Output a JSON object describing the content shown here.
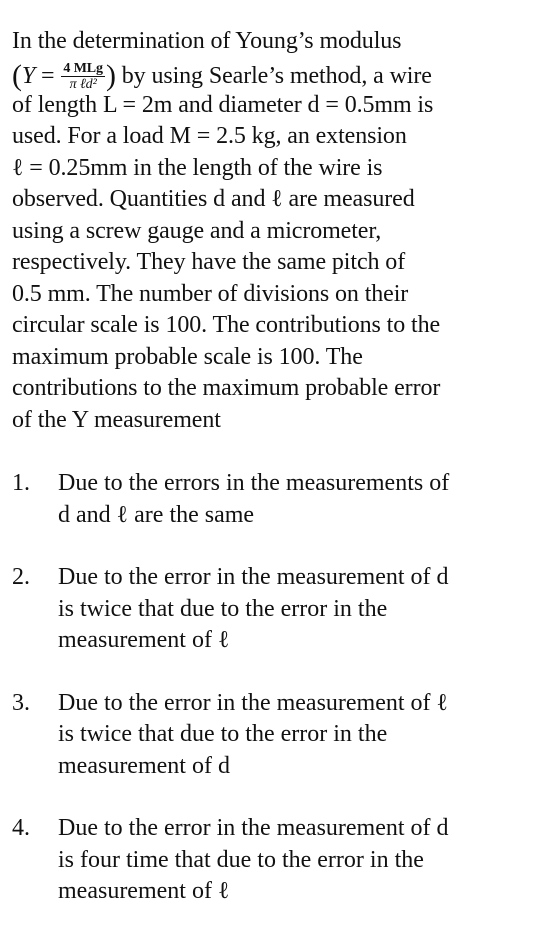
{
  "question": {
    "intro": "In the determination of Young’s modulus",
    "formula": {
      "lhs": "Y",
      "eq": "=",
      "numerator": "4 MLg",
      "denominator": "π ℓd²"
    },
    "line2_tail": "by using Searle’s method, a wire",
    "line3": "of length L = 2m and diameter d = 0.5mm is",
    "line4": "used. For a load M = 2.5 kg, an extension",
    "line5": "ℓ = 0.25mm in the length of the wire is",
    "line6": "observed. Quantities d and ℓ are measured",
    "line7": "using a screw gauge and a micrometer,",
    "line8": "respectively. They have the same pitch of",
    "line9": "0.5 mm. The number of divisions on their",
    "line10": "circular scale is 100. The contributions to the",
    "line11": "maximum probable scale is 100. The",
    "line12": "contributions to the maximum probable error",
    "line13": "of the Y measurement"
  },
  "options": [
    {
      "number": "1.",
      "line1": "Due to the errors in the measurements of",
      "line2": "d and ℓ are the same",
      "line3": ""
    },
    {
      "number": "2.",
      "line1": "Due to the error in the measurement of d",
      "line2": "is twice that due to the error in the",
      "line3": "measurement of ℓ"
    },
    {
      "number": "3.",
      "line1": "Due to the error in the measurement of ℓ",
      "line2": "is twice that due to the error in the",
      "line3": "measurement of d"
    },
    {
      "number": "4.",
      "line1": "Due to the error in the measurement of d",
      "line2": "is four time that due to the error in the",
      "line3": "measurement of ℓ"
    }
  ]
}
